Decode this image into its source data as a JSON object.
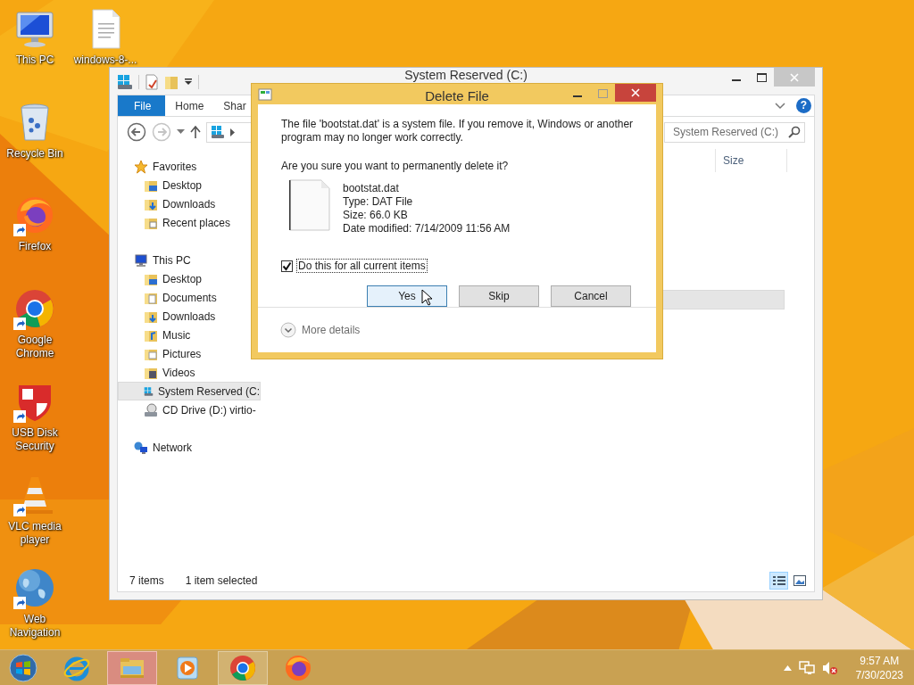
{
  "desktop": {
    "icons": [
      {
        "label": "This PC",
        "kind": "pc",
        "shortcut": false
      },
      {
        "label": "windows-8-...",
        "kind": "document",
        "shortcut": false
      },
      {
        "label": "Recycle Bin",
        "kind": "recycle",
        "shortcut": false
      },
      {
        "label": "Firefox",
        "kind": "firefox",
        "shortcut": true
      },
      {
        "label": "Google Chrome",
        "kind": "chrome",
        "shortcut": true
      },
      {
        "label": "USB Disk Security",
        "kind": "shield",
        "shortcut": true
      },
      {
        "label": "VLC media player",
        "kind": "vlc",
        "shortcut": true
      },
      {
        "label": "Web Navigation",
        "kind": "globe",
        "shortcut": true
      }
    ]
  },
  "explorer": {
    "title": "System Reserved (C:)",
    "ribbon_tabs": [
      {
        "label": "File",
        "selected": true
      },
      {
        "label": "Home",
        "selected": false
      },
      {
        "label": "Shar",
        "selected": false
      }
    ],
    "help": "?",
    "nav_buttons": [
      {
        "kind": "back",
        "disabled": false
      },
      {
        "kind": "forward",
        "disabled": true
      }
    ],
    "search": {
      "placeholder": "System Reserved (C:)"
    },
    "columns": [
      "Size"
    ],
    "file_rows": [
      {
        "selected": true
      }
    ],
    "sidebar": [
      {
        "label": "Favorites",
        "kind": "favorites",
        "selected": false,
        "children": [
          {
            "label": "Desktop",
            "kind": "desktop",
            "selected": false
          },
          {
            "label": "Downloads",
            "kind": "downloads",
            "selected": false
          },
          {
            "label": "Recent places",
            "kind": "recent",
            "selected": false
          }
        ]
      },
      {
        "label": "This PC",
        "kind": "pc",
        "selected": false,
        "children": [
          {
            "label": "Desktop",
            "kind": "desktop",
            "selected": false
          },
          {
            "label": "Documents",
            "kind": "documents",
            "selected": false
          },
          {
            "label": "Downloads",
            "kind": "downloads",
            "selected": false
          },
          {
            "label": "Music",
            "kind": "music",
            "selected": false
          },
          {
            "label": "Pictures",
            "kind": "pictures",
            "selected": false
          },
          {
            "label": "Videos",
            "kind": "videos",
            "selected": false
          },
          {
            "label": "System Reserved (C:",
            "kind": "drive",
            "selected": true
          },
          {
            "label": "CD Drive (D:) virtio-",
            "kind": "cd",
            "selected": false
          }
        ]
      },
      {
        "label": "Network",
        "kind": "network",
        "selected": false
      }
    ],
    "status_bar": {
      "count": "7 items",
      "selection": "1 item selected"
    },
    "views": [
      {
        "kind": "details",
        "selected": true
      },
      {
        "kind": "large",
        "selected": false
      }
    ]
  },
  "dialog": {
    "title": "Delete File",
    "message": "The file 'bootstat.dat' is a system file. If you remove it, Windows or another program may no longer work correctly.",
    "question": "Are you sure you want to permanently delete it?",
    "file": {
      "name": "bootstat.dat",
      "type": "Type: DAT File",
      "size": "Size: 66.0 KB",
      "modified": "Date modified: 7/14/2009 11:56 AM"
    },
    "checkbox": {
      "label": "Do this for all current items",
      "checked": true
    },
    "buttons": [
      {
        "label": "Yes",
        "highlighted": true
      },
      {
        "label": "Skip",
        "highlighted": false
      },
      {
        "label": "Cancel",
        "highlighted": false
      }
    ],
    "details": "More details"
  },
  "taskbar": {
    "items": [
      {
        "kind": "start",
        "running": false,
        "selected": false
      },
      {
        "kind": "ie",
        "running": false,
        "selected": false
      },
      {
        "kind": "explorer",
        "running": true,
        "selected": true
      },
      {
        "kind": "media",
        "running": false,
        "selected": false
      },
      {
        "kind": "chrome",
        "running": true,
        "selected": false
      },
      {
        "kind": "firefox",
        "running": false,
        "selected": false
      }
    ],
    "tray": [
      {
        "kind": "show-hidden"
      },
      {
        "kind": "network"
      },
      {
        "kind": "volume",
        "muted": true
      }
    ],
    "time": "9:57 AM",
    "date": "7/30/2023"
  }
}
